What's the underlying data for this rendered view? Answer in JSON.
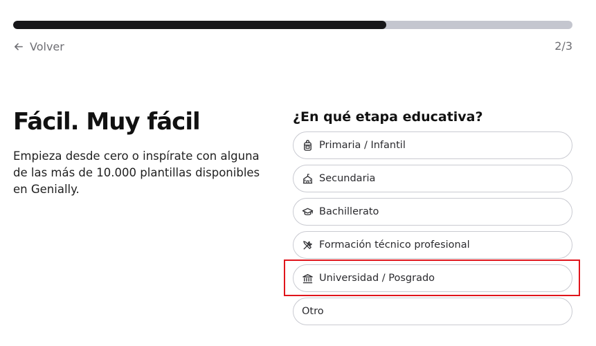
{
  "progress": {
    "fraction": 0.667
  },
  "nav": {
    "back_label": "Volver",
    "step": "2/3"
  },
  "hero": {
    "title": "Fácil. Muy fácil",
    "text": "Empieza desde cero o inspírate con alguna de las más de 10.000 plantillas disponibles en Genially."
  },
  "question": "¿En qué etapa educativa?",
  "options": [
    {
      "label": "Primaria / Infantil",
      "icon": "backpack-icon"
    },
    {
      "label": "Secundaria",
      "icon": "school-building-icon"
    },
    {
      "label": "Bachillerato",
      "icon": "graduation-cap-icon"
    },
    {
      "label": "Formación técnico profesional",
      "icon": "tools-icon"
    },
    {
      "label": "Universidad / Posgrado",
      "icon": "university-icon"
    },
    {
      "label": "Otro",
      "icon": ""
    }
  ],
  "colors": {
    "accent_dark": "#17171a",
    "track": "#c4c6cf",
    "highlight": "#e0141b"
  }
}
